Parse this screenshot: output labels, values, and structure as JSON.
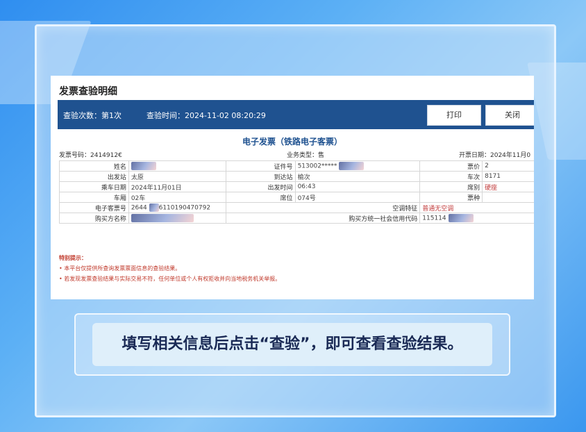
{
  "document": {
    "title": "发票查验明细",
    "info_bar": {
      "check_count": "查验次数：第1次",
      "check_time": "查验时间：2024-11-02 08:20:29",
      "print_label": "打印",
      "close_label": "关闭"
    },
    "invoice": {
      "title": "电子发票（铁路电子客票）",
      "invoice_no": "发票号码：2414912€",
      "business_type": "业务类型：售",
      "issue_date": "开票日期：2024年11月0",
      "rows": {
        "name_label": "姓名",
        "id_label": "证件号",
        "id_value": "513002*****",
        "fare_label": "票价",
        "fare_value": "2",
        "depart_station_label": "出发站",
        "depart_station_value": "太原",
        "arrive_station_label": "到达站",
        "arrive_station_value": "榆次",
        "train_label": "车次",
        "train_value": "8171",
        "ride_date_label": "乘车日期",
        "ride_date_value": "2024年11月01日",
        "depart_time_label": "出发时间",
        "depart_time_value": "06:43",
        "seat_class_label": "席别",
        "seat_class_value": "硬座",
        "car_label": "车厢",
        "car_value": "02车",
        "seat_label": "席位",
        "seat_value": "074号",
        "ticket_type_label": "票种",
        "eticket_label": "电子客票号",
        "eticket_value_start": "2644",
        "eticket_value_end": "6110190470792",
        "ac_label": "空调特征",
        "ac_value": "普通无空调",
        "buyer_name_label": "购买方名称",
        "buyer_code_label": "购买方统一社会信用代码",
        "buyer_code_value": "115114"
      }
    },
    "tips": {
      "head": "特别提示：",
      "line1": "• 本平台仅提供所查询发票票面信息的查验结果。",
      "line2": "• 若发现发票查验结果与实际交易不符，任何单位或个人有权拒收并向当地税务机关举报。"
    }
  },
  "caption": "填写相关信息后点击“查验”，即可查看查验结果。"
}
